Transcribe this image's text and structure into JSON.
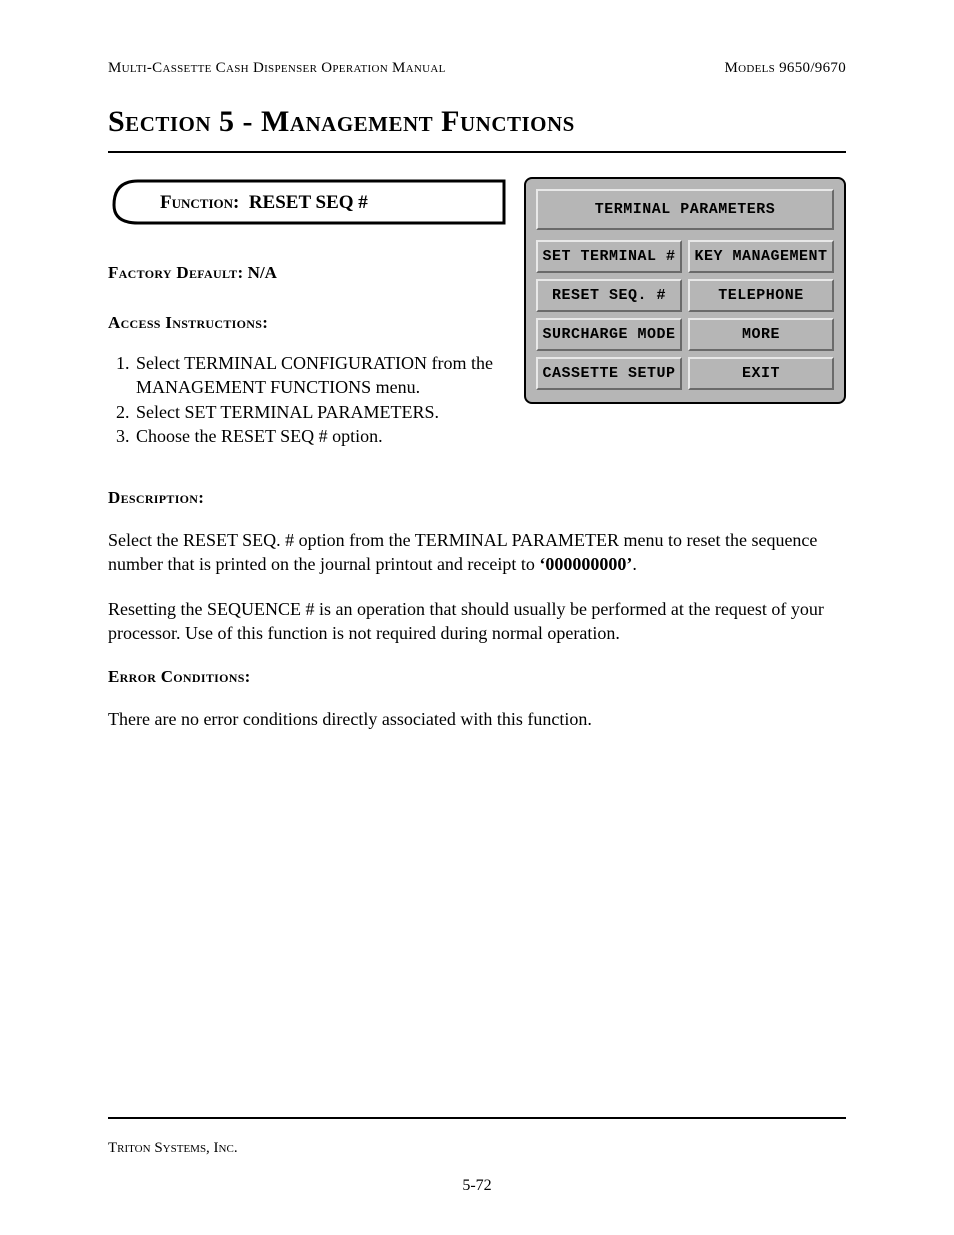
{
  "header": {
    "left": "Multi-Cassette Cash Dispenser Operation Manual",
    "right": "Models 9650/9670"
  },
  "section_title": "Section 5 - Management Functions",
  "function_tab": {
    "label_prefix": "Function:",
    "name": "RESET SEQ #"
  },
  "factory_default": {
    "label": "Factory Default:",
    "value": "N/A"
  },
  "access": {
    "label": "Access Instructions:",
    "steps": [
      "Select TERMINAL CONFIGURATION from the MANAGEMENT FUNCTIONS menu.",
      "Select SET TERMINAL PARAMETERS.",
      "Choose the RESET SEQ # option."
    ]
  },
  "description": {
    "label": "Description:",
    "p1_a": "Select the RESET SEQ. # option from the TERMINAL PARAMETER menu to reset the sequence number that is printed on the journal printout and receipt to ",
    "p1_bold": "‘000000000’",
    "p1_b": ".",
    "p2": "Resetting the SEQUENCE # is an operation that should usually be performed at the request of your processor. Use of this function is not required during normal operation."
  },
  "error": {
    "label": "Error Conditions:",
    "text": "There are no error conditions directly associated with this function."
  },
  "terminal": {
    "title": "TERMINAL PARAMETERS",
    "buttons": [
      "SET TERMINAL #",
      "KEY MANAGEMENT",
      "RESET SEQ. #",
      "TELEPHONE",
      "SURCHARGE MODE",
      "MORE",
      "CASSETTE SETUP",
      "EXIT"
    ]
  },
  "footer": {
    "company": "Triton Systems, Inc.",
    "page": "5-72"
  }
}
